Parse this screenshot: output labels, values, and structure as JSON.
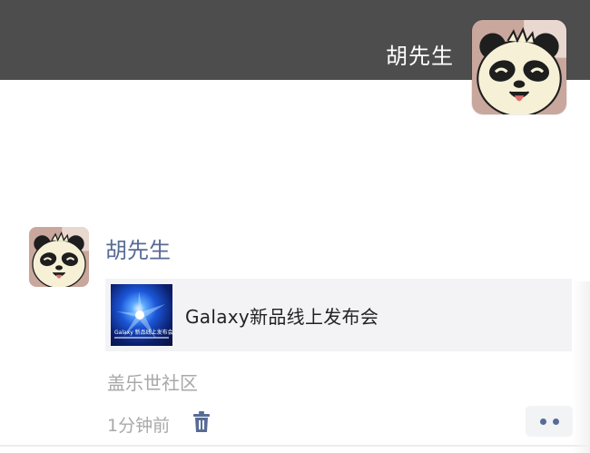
{
  "cover": {
    "username": "胡先生",
    "avatar_icon": "panda-avatar-icon",
    "background_color": "#4d4d4d"
  },
  "post": {
    "author": "胡先生",
    "avatar_icon": "panda-avatar-icon",
    "link_card": {
      "title": "Galaxy新品线上发布会",
      "thumbnail_text": "Galaxy 新品线上发布会"
    },
    "location": "盖乐世社区",
    "time": "1分钟前",
    "delete_icon": "trash-icon",
    "more_icon": "more-dots-icon"
  },
  "colors": {
    "name_link": "#576b95",
    "meta_gray": "#a8a8a8"
  }
}
